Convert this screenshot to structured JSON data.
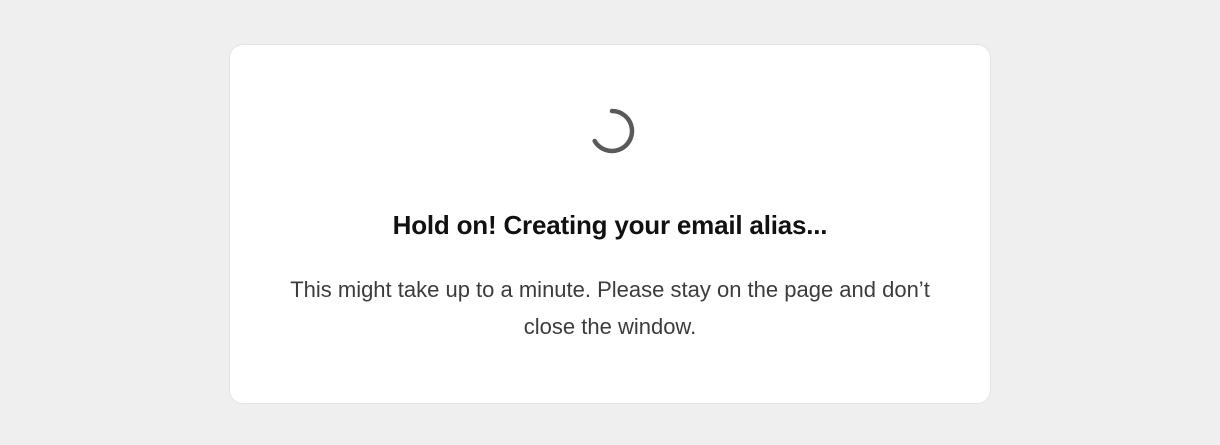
{
  "loader": {
    "spinner_icon": "loading-spinner-icon",
    "spinner_color": "#555555",
    "heading": "Hold on! Creating your email alias...",
    "message": "This might take up to a minute. Please stay on the page and don’t close the window."
  },
  "colors": {
    "page_background": "#efefef",
    "card_background": "#ffffff",
    "heading_text": "#111111",
    "body_text": "#3c3c3c"
  }
}
